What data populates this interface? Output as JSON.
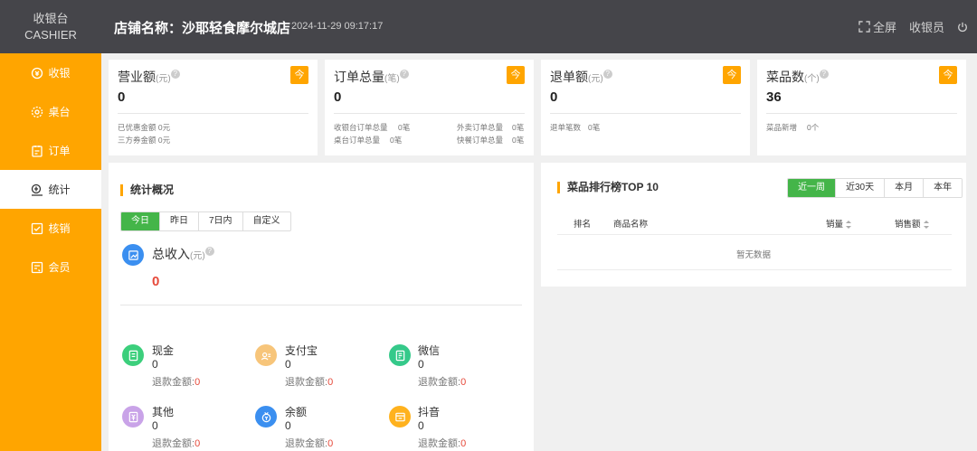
{
  "header": {
    "brand_cn": "收银台",
    "brand_en": "CASHIER",
    "store_label": "店铺名称：沙耶轻食摩尔城店",
    "datetime": "2024-11-29 09:17:17",
    "fullscreen_label": "全屏",
    "user_label": "收银员"
  },
  "sidebar": {
    "items": [
      {
        "label": "收银",
        "icon": "cashier-icon"
      },
      {
        "label": "桌台",
        "icon": "table-icon"
      },
      {
        "label": "订单",
        "icon": "order-icon"
      },
      {
        "label": "统计",
        "icon": "statistics-icon"
      },
      {
        "label": "核销",
        "icon": "verify-icon"
      },
      {
        "label": "会员",
        "icon": "member-icon"
      }
    ],
    "active": "统计"
  },
  "stats": {
    "revenue": {
      "title": "营业额",
      "unit": "(元)",
      "badge": "今",
      "value": "0",
      "sub1": "已优惠金额 0元",
      "sub2": "三方券金额 0元"
    },
    "orders": {
      "title": "订单总量",
      "unit": "(笔)",
      "badge": "今",
      "value": "0",
      "sub1": "收银台订单总量",
      "sub1_val": "0笔",
      "sub2": "桌台订单总量",
      "sub2_val": "0笔",
      "sub3": "外卖订单总量",
      "sub3_val": "0笔",
      "sub4": "快餐订单总量",
      "sub4_val": "0笔"
    },
    "refund": {
      "title": "退单额",
      "unit": "(元)",
      "badge": "今",
      "value": "0",
      "sub1": "退单笔数",
      "sub1_val": "0笔"
    },
    "dishes": {
      "title": "菜品数",
      "unit": "(个)",
      "badge": "今",
      "value": "36",
      "sub1": "菜品新增",
      "sub1_val": "0个"
    }
  },
  "overview": {
    "title": "统计概况",
    "tabs": [
      "今日",
      "昨日",
      "7日内",
      "自定义"
    ],
    "active_tab": "今日",
    "income_title": "总收入",
    "income_unit": "(元)",
    "income_value": "0",
    "refund_label": "退款金额:",
    "payments": [
      {
        "name": "现金",
        "value": "0",
        "refund": "0",
        "color": "#3ccf7c",
        "icon": "cash-icon"
      },
      {
        "name": "支付宝",
        "value": "0",
        "refund": "0",
        "color": "#f7c57a",
        "icon": "alipay-icon"
      },
      {
        "name": "微信",
        "value": "0",
        "refund": "0",
        "color": "#35c98a",
        "icon": "wechat-icon"
      },
      {
        "name": "其他",
        "value": "0",
        "refund": "0",
        "color": "#c9a3e8",
        "icon": "other-icon"
      },
      {
        "name": "余额",
        "value": "0",
        "refund": "0",
        "color": "#3b8ff0",
        "icon": "balance-icon"
      },
      {
        "name": "抖音",
        "value": "0",
        "refund": "0",
        "color": "#ffb21e",
        "icon": "douyin-icon"
      }
    ]
  },
  "ranking": {
    "title": "菜品排行榜TOP 10",
    "tabs": [
      "近一周",
      "近30天",
      "本月",
      "本年"
    ],
    "active_tab": "近一周",
    "columns": [
      "排名",
      "商品名称",
      "销量",
      "销售额"
    ],
    "empty_text": "暂无数据"
  },
  "colors": {
    "accent": "#ffa500",
    "green": "#44b549",
    "topbar": "#45454a",
    "red": "#e64a3b"
  }
}
